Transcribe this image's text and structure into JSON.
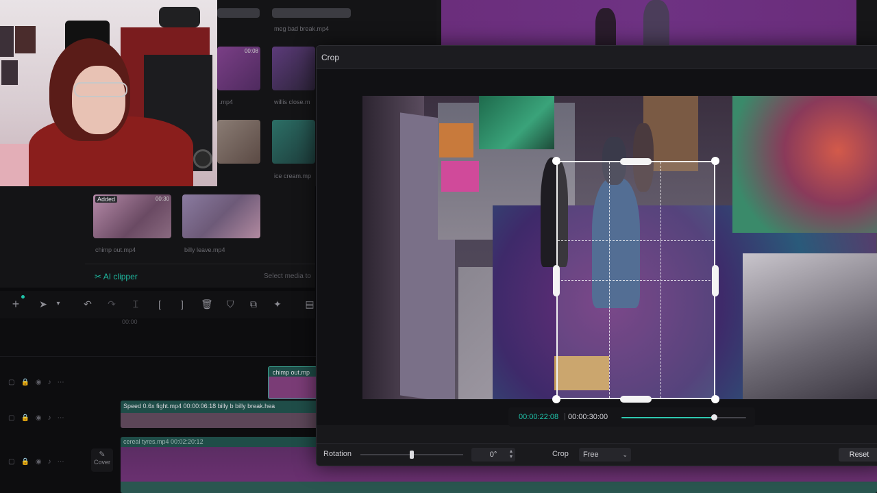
{
  "library": {
    "thumbs": [
      {
        "label": "meg bad break.mp4",
        "duration": ""
      },
      {
        "label": ".mp4",
        "duration": "00:08"
      },
      {
        "label": "willis close.m",
        "duration": ""
      },
      {
        "label": "ice cream.mp",
        "duration": ""
      },
      {
        "label": "chimp out.mp4",
        "duration": "00:30",
        "badge": "Added"
      },
      {
        "label": "billy leave.mp4",
        "duration": ""
      }
    ],
    "ai_clipper": "AI clipper",
    "select_media": "Select media to"
  },
  "timeline": {
    "ruler_start": "00:00",
    "clips": [
      {
        "label": "chimp out.mp"
      },
      {
        "label": "Speed 0.6x  fight.mp4  00:00:06:18  billy b  billy break.hea"
      },
      {
        "label": "cereal tyres.mp4  00:02:20:12"
      }
    ],
    "cover_label": "Cover"
  },
  "crop_dialog": {
    "title": "Crop",
    "time_current": "00:00:22:08",
    "time_separator": "|",
    "time_total": "00:00:30:00",
    "progress_fraction": 0.74,
    "rotation_label": "Rotation",
    "rotation_value": "0°",
    "rotation_fraction": 0.5,
    "crop_label": "Crop",
    "crop_mode": "Free",
    "reset_label": "Reset"
  },
  "colors": {
    "accent": "#1fc4aa",
    "purple_preview": "#6e3283"
  }
}
